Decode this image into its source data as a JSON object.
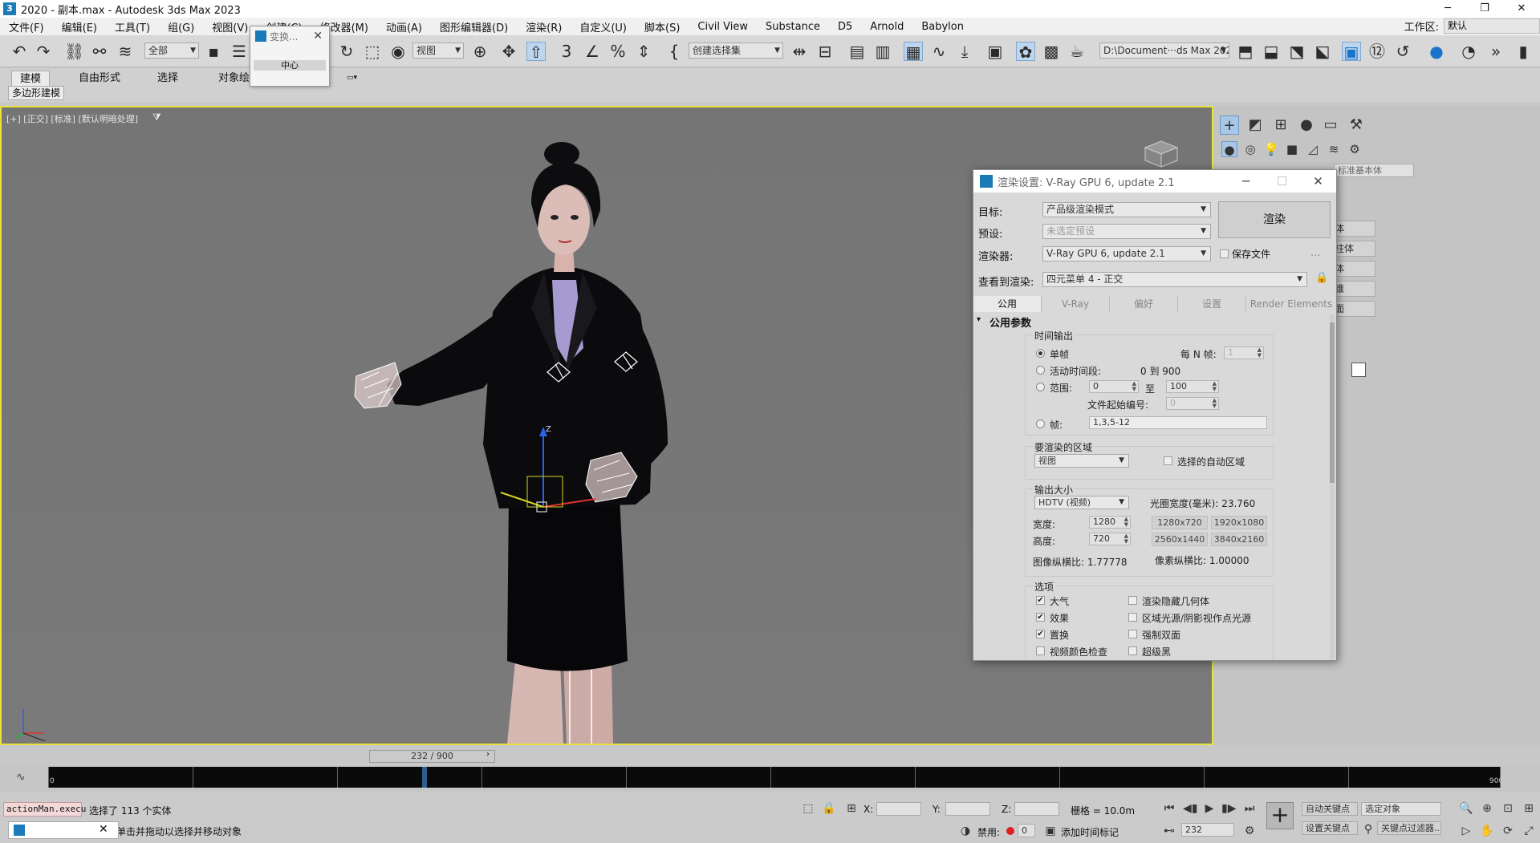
{
  "window": {
    "title": "2020 - 副本.max - Autodesk 3ds Max 2023",
    "minimize": "─",
    "restore": "❐",
    "close": "✕"
  },
  "menubar": {
    "items": [
      "文件(F)",
      "编辑(E)",
      "工具(T)",
      "组(G)",
      "视图(V)",
      "创建(C)",
      "修改器(M)",
      "动画(A)",
      "图形编辑器(D)",
      "渲染(R)",
      "自定义(U)",
      "脚本(S)",
      "Civil View",
      "Substance",
      "D5",
      "Arnold",
      "Babylon"
    ],
    "workspace_label": "工作区:",
    "workspace_value": "默认"
  },
  "toolbar": {
    "selection_filter": "全部",
    "view_coord": "视图",
    "named_selection": "创建选择集",
    "project_path": "D:\\Document···ds Max 2023"
  },
  "ribbon": {
    "tabs": [
      "建模",
      "自由形式",
      "选择",
      "对象绘"
    ],
    "subtab": "多边形建模"
  },
  "float_dialog": {
    "title": "变换...",
    "button": "中心"
  },
  "viewport": {
    "label": "[+] [正交] [标准] [默认明暗处理]"
  },
  "render_dialog": {
    "title": "渲染设置: V-Ray GPU 6, update 2.1",
    "target_label": "目标:",
    "target_value": "产品级渲染模式",
    "preset_label": "预设:",
    "preset_value": "未选定预设",
    "renderer_label": "渲染器:",
    "renderer_value": "V-Ray GPU 6, update 2.1",
    "save_file": "保存文件",
    "more": "...",
    "view_label": "查看到渲染:",
    "view_value": "四元菜单 4 - 正交",
    "render_button": "渲染",
    "tabs": [
      "公用",
      "V-Ray",
      "偏好",
      "设置",
      "Render Elements"
    ],
    "rollout_title": "公用参数",
    "time_output": {
      "header": "时间输出",
      "single": "单帧",
      "every_n": "每 N 帧:",
      "every_n_value": "1",
      "active": "活动时间段:",
      "active_range": "0 到 900",
      "range": "范围:",
      "range_from": "0",
      "range_to_label": "至",
      "range_to": "100",
      "file_start": "文件起始编号:",
      "file_start_value": "0",
      "frames": "帧:",
      "frames_value": "1,3,5-12"
    },
    "area": {
      "header": "要渲染的区域",
      "value": "视图",
      "auto": "选择的自动区域"
    },
    "output_size": {
      "header": "输出大小",
      "preset": "HDTV (视频)",
      "aperture": "光圈宽度(毫米): 23.760",
      "width_label": "宽度:",
      "width": "1280",
      "height_label": "高度:",
      "height": "720",
      "presets": [
        "1280x720",
        "1920x1080",
        "2560x1440",
        "3840x2160"
      ],
      "image_aspect": "图像纵横比: 1.77778",
      "pixel_aspect": "像素纵横比: 1.00000"
    },
    "options": {
      "header": "选项",
      "items": [
        {
          "label": "大气",
          "checked": "✔"
        },
        {
          "label": "渲染隐藏几何体",
          "checked": ""
        },
        {
          "label": "效果",
          "checked": "✔"
        },
        {
          "label": "区域光源/阴影视作点光源",
          "checked": ""
        },
        {
          "label": "置换",
          "checked": "✔"
        },
        {
          "label": "强制双面",
          "checked": ""
        },
        {
          "label": "视频颜色检查",
          "checked": ""
        },
        {
          "label": "超级黑",
          "checked": ""
        }
      ]
    }
  },
  "command_panel": {
    "partial_label": "标准基本体",
    "buttons": [
      "体",
      "柱体",
      "体",
      "锥",
      "面"
    ]
  },
  "time_slider": {
    "value": "232 / 900"
  },
  "timeline": {
    "ticks": [
      "0",
      "100",
      "200",
      "300",
      "400",
      "500",
      "600",
      "700",
      "800",
      "900"
    ]
  },
  "status": {
    "maxscript": "actionMan.execu",
    "selection": "选择了 113 个实体",
    "prompt": "单击并拖动以选择并移动对象",
    "x_label": "X:",
    "y_label": "Y:",
    "z_label": "Z:",
    "grid": "栅格 = 10.0m",
    "disabled": "禁用:",
    "disabled_value": "0",
    "add_time_tag": "添加时间标记",
    "auto_key": "自动关键点",
    "selected_objects": "选定对象",
    "set_key": "设置关键点",
    "key_filters": "关键点过滤器...",
    "current_frame": "232"
  },
  "colors": {
    "viewport_border": "#e8e23b",
    "brand": "#1b7ab8"
  }
}
